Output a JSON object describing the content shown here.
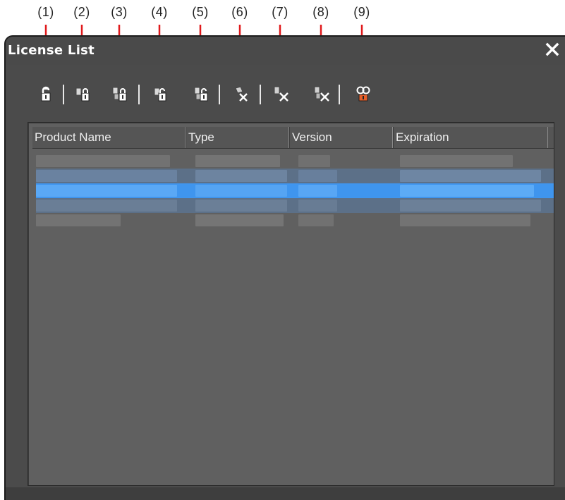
{
  "callouts": [
    "(1)",
    "(2)",
    "(3)",
    "(4)",
    "(5)",
    "(6)",
    "(7)",
    "(8)",
    "(9)"
  ],
  "window": {
    "title": "License List",
    "close_label": "✕"
  },
  "toolbar": {
    "buttons": [
      {
        "icon": "license-retrieve-icon"
      },
      {
        "icon": "license-checkout-icon"
      },
      {
        "icon": "license-checkout-all-icon"
      },
      {
        "icon": "license-return-icon"
      },
      {
        "icon": "license-return-all-icon"
      },
      {
        "icon": "license-remove-icon"
      },
      {
        "icon": "license-disable-icon"
      },
      {
        "icon": "license-disable-all-icon"
      },
      {
        "icon": "license-info-icon"
      }
    ]
  },
  "list": {
    "columns": [
      "Product Name",
      "Type",
      "Version",
      "Expiration"
    ],
    "selected_row": 2
  },
  "colors": {
    "window_bg": "#4b4b4b",
    "list_bg": "#606060",
    "selection": "#3f95ee",
    "arrow": "#e0191b"
  }
}
